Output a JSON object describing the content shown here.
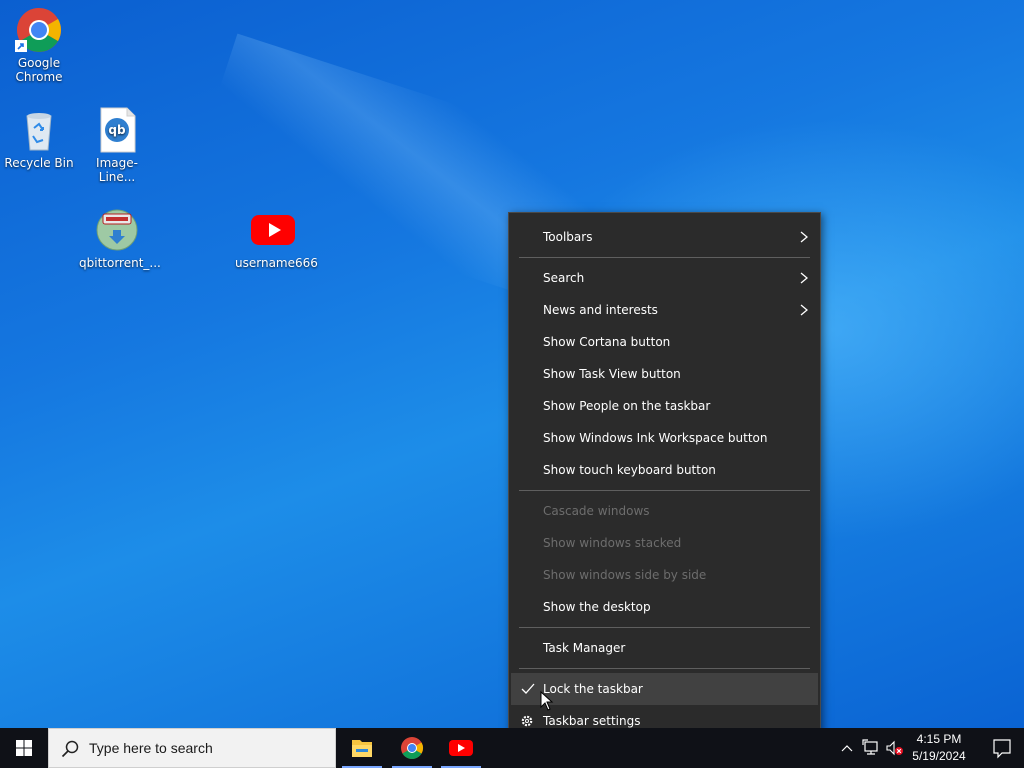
{
  "desktop": {
    "icons": [
      {
        "label": "Google\nChrome",
        "icon": "chrome-icon"
      },
      {
        "label": "Recycle Bin",
        "icon": "recycle-bin-icon"
      },
      {
        "label": "Image-Line...",
        "icon": "qbittorrent-file-icon"
      },
      {
        "label": "qbittorrent_...",
        "icon": "installer-icon"
      },
      {
        "label": "username666",
        "icon": "youtube-icon"
      }
    ]
  },
  "context_menu": {
    "items": [
      {
        "label": "Toolbars",
        "submenu": true
      },
      {
        "label": "Search",
        "submenu": true
      },
      {
        "label": "News and interests",
        "submenu": true
      },
      {
        "label": "Show Cortana button"
      },
      {
        "label": "Show Task View button"
      },
      {
        "label": "Show People on the taskbar"
      },
      {
        "label": "Show Windows Ink Workspace button"
      },
      {
        "label": "Show touch keyboard button"
      },
      {
        "label": "Cascade windows",
        "disabled": true
      },
      {
        "label": "Show windows stacked",
        "disabled": true
      },
      {
        "label": "Show windows side by side",
        "disabled": true
      },
      {
        "label": "Show the desktop"
      },
      {
        "label": "Task Manager"
      },
      {
        "label": "Lock the taskbar",
        "checked": true,
        "hovered": true
      },
      {
        "label": "Taskbar settings",
        "icon": "gear-icon"
      }
    ]
  },
  "taskbar": {
    "search_placeholder": "Type here to search",
    "pinned": [
      "file-explorer-icon",
      "chrome-icon",
      "youtube-icon"
    ],
    "clock": {
      "time": "4:15 PM",
      "date": "5/19/2024"
    }
  },
  "colors": {
    "accent": "#0078d7",
    "menu_bg": "#2b2b2b",
    "taskbar_bg": "#0f1117"
  }
}
